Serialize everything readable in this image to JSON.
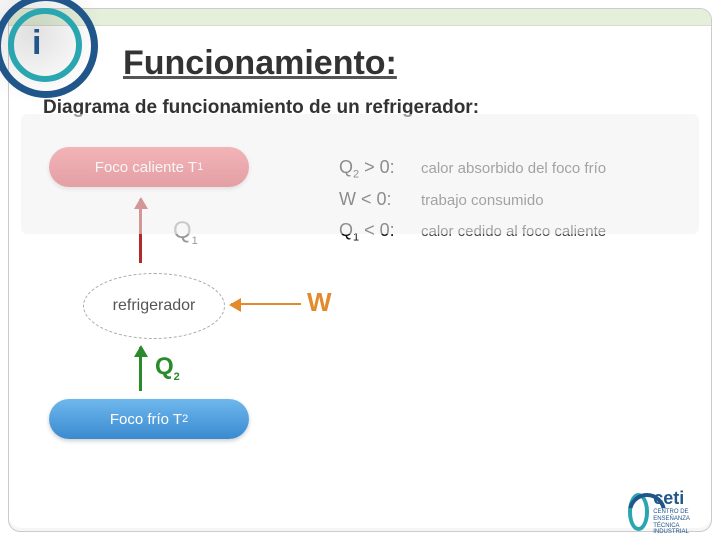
{
  "title": "Funcionamiento:",
  "subtitle": "Diagrama de funcionamiento de un refrigerador:",
  "diagram": {
    "hot_focus": "Foco caliente T",
    "hot_sub": "1",
    "cold_focus": "Foco frío T",
    "cold_sub": "2",
    "refrigerator": "refrigerador",
    "q1_label": "Q",
    "q1_sub": "1",
    "q2_label": "Q",
    "q2_sub": "2",
    "w_label": "W"
  },
  "legend": [
    {
      "term": "Q",
      "term_sub": "2",
      "cond": " > 0:",
      "desc": "calor absorbido del foco frío"
    },
    {
      "term": "W",
      "term_sub": "",
      "cond": " < 0:",
      "desc": "trabajo consumido"
    },
    {
      "term": "Q",
      "term_sub": "1",
      "cond": " < 0:",
      "desc": "calor cedido al foco caliente"
    }
  ],
  "badge": {
    "name": "ceti",
    "caption": "CENTRO DE ENSEÑANZA TÉCNICA INDUSTRIAL"
  }
}
